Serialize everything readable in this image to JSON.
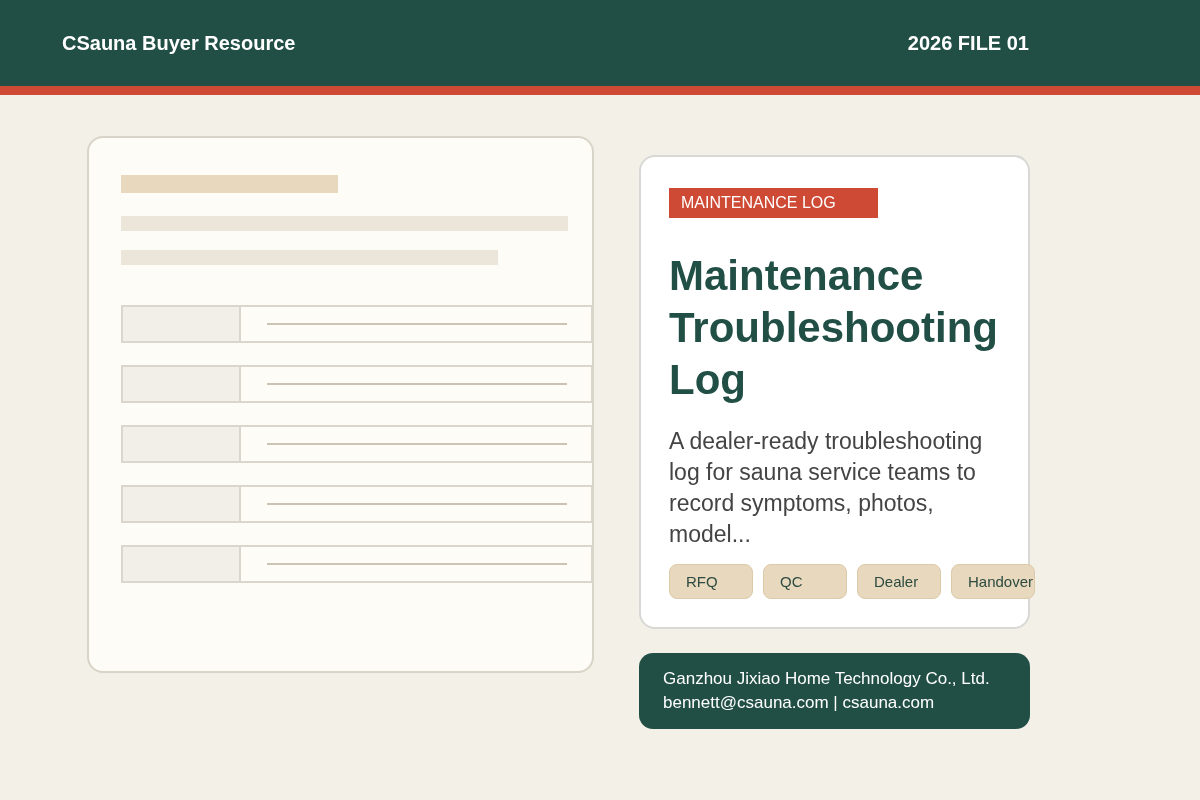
{
  "header": {
    "brand": "CSauna Buyer Resource",
    "file_label": "2026 FILE 01"
  },
  "hero": {
    "badge": "MAINTENANCE LOG",
    "title": "Maintenance Troubleshooting Log",
    "description": "A dealer-ready troubleshooting log for sauna service teams to record symptoms, photos, model...",
    "tags": [
      "RFQ",
      "QC",
      "Dealer",
      "Handover"
    ]
  },
  "contact": {
    "company": "Ganzhou Jixiao Home Technology Co., Ltd.",
    "email_line": "bennett@csauna.com | csauna.com"
  }
}
